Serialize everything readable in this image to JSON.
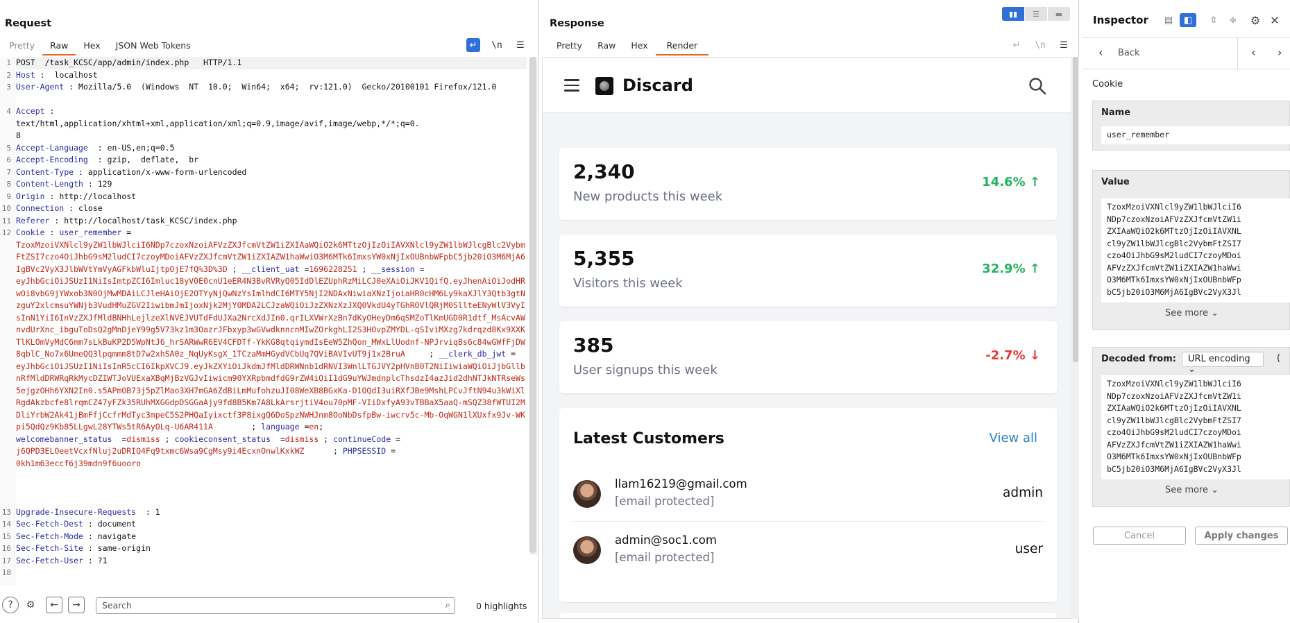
{
  "request": {
    "title": "Request",
    "tabs": [
      "Pretty",
      "Raw",
      "Hex",
      "JSON Web Tokens"
    ],
    "active_tab": "Raw",
    "lines": [
      {
        "n": "1",
        "h": 1,
        "parts": [
          {
            "c": "plain",
            "t": "POST  /task_KCSC/app/admin/index.php   HTTP/1.1"
          }
        ]
      },
      {
        "n": "2",
        "h": 1,
        "parts": [
          {
            "c": "hk",
            "t": "Host"
          },
          {
            "c": "sep",
            "t": " :  localhost"
          }
        ]
      },
      {
        "n": "3",
        "h": 2,
        "parts": [
          {
            "c": "hk",
            "t": "User-Agent"
          },
          {
            "c": "sep",
            "t": " : Mozilla/5.0  (Windows  NT  10.0;  Win64;  x64;  rv:121.0)  Gecko/20100101 Firefox/121.0"
          }
        ]
      },
      {
        "n": "4",
        "h": 3,
        "parts": [
          {
            "c": "hk",
            "t": "Accept"
          },
          {
            "c": "sep",
            "t": " :\ntext/html,application/xhtml+xml,application/xml;q=0.9,image/avif,image/webp,*/*;q=0.\n8"
          }
        ]
      },
      {
        "n": "5",
        "h": 1,
        "parts": [
          {
            "c": "hk",
            "t": "Accept-Language"
          },
          {
            "c": "sep",
            "t": "  : en-US,en;q=0.5"
          }
        ]
      },
      {
        "n": "6",
        "h": 1,
        "parts": [
          {
            "c": "hk",
            "t": "Accept-Encoding"
          },
          {
            "c": "sep",
            "t": "  : gzip,  deflate,  br"
          }
        ]
      },
      {
        "n": "7",
        "h": 1,
        "parts": [
          {
            "c": "hk",
            "t": "Content-Type"
          },
          {
            "c": "sep",
            "t": " : application/x-www-form-urlencoded"
          }
        ]
      },
      {
        "n": "8",
        "h": 1,
        "parts": [
          {
            "c": "hk",
            "t": "Content-Length"
          },
          {
            "c": "sep",
            "t": " : 129"
          }
        ]
      },
      {
        "n": "9",
        "h": 1,
        "parts": [
          {
            "c": "hk",
            "t": "Origin"
          },
          {
            "c": "sep",
            "t": " : http://localhost"
          }
        ]
      },
      {
        "n": "10",
        "h": 1,
        "parts": [
          {
            "c": "hk",
            "t": "Connection"
          },
          {
            "c": "sep",
            "t": " : close"
          }
        ]
      },
      {
        "n": "11",
        "h": 1,
        "parts": [
          {
            "c": "hk",
            "t": "Referer"
          },
          {
            "c": "sep",
            "t": " : http://localhost/task_KCSC/index.php"
          }
        ]
      },
      {
        "n": "12",
        "h": 23,
        "parts": [
          {
            "c": "hk",
            "t": "Cookie"
          },
          {
            "c": "sep",
            "t": " : "
          },
          {
            "c": "ck",
            "t": "user_remember"
          },
          {
            "c": "sep",
            "t": " =\n"
          },
          {
            "c": "cv",
            "t": "TzoxMzoiVXNlcl9yZW1lbWJlciI6NDp7czoxNzoiAFVzZXJfcmVtZW1iZXIAaWQiO2k6MTtzOjIzOiIAVXNlcl9yZW1lbWJlcgBlc2VybmFtZSI7czo4OiJhbG9sM2ludCI7czoyMDoiAFVzZXJfcmVtZW1iZXIAZW1haWwiO3M6MTk6ImxsYW0xNjIxOUBnbWFpbC5jb20iO3M6MjA6IgBVc2VyX3JlbWVtYmVyAGFkbWluIjtpOjE7fQ%3D%3D"
          },
          {
            "c": "sep",
            "t": " ; "
          },
          {
            "c": "ck",
            "t": "__client_uat"
          },
          {
            "c": "sep",
            "t": " ="
          },
          {
            "c": "cv",
            "t": "1696228251"
          },
          {
            "c": "sep",
            "t": " ; "
          },
          {
            "c": "ck",
            "t": "__session"
          },
          {
            "c": "sep",
            "t": " =\n"
          },
          {
            "c": "cv",
            "t": "eyJhbGciOiJSUzI1NiIsImtpZCI6Imluc18yV0E0cnU1eER4N3BvRVRyQ05IdDlEZUphRzMiLCJ0eXAiOiJKV1QifQ.eyJhenAiOiJodHRwOi8vbG9jYWxob3N0OjMwMDAiLCJleHAiOjE2OTYyNjQwNzYsImlhdCI6MTY5NjI2NDAxNiwiaXNzIjoiaHR0cHM6Ly9kaXJlY3Qtb3gtNzguY2xlcmsuYWNjb3VudHMuZGV2IiwibmJmIjoxNjk2MjY0MDA2LCJzaWQiOiJzZXNzXzJXQ0VkdU4yTGhROVlQRjM0SllteENyWlV3VyIsInN1YiI6InVzZXJfMldBNHhLejlzeXlNVEJVUTdFdUJXa2NrcXdJIn0.qrILXVWrXzBn7dKyOHeyDm6qSMZoTlKmUGD0R1dtf_MsAcvAWnvdUrXnc_ibguToDsQ2gMnDjeY99g5V73kz1m3OazrJFbxyp3wGVwdknncnMIwZOrkghLI2S3HOvpZMYDL-qSIviMXzg7kdrqzd8Kx9XXKTlKLOmVyMdC6mm7sLkBuKP2D5WpNtJ6_hrSARWwR6EV4CFDTf-YkKG8qtqiymdIsEeW5ZhQon_MWxLlUodnf-NPJrviqBs6c84wGWfFjDW8qblC_No7x6UmeQQ3lpqmmm8tD7w2xhSA0z_NqUyKsgX_1TCzaMmHGydVCbUq7QViBAVIvUT9j1x2BruA"
          },
          {
            "c": "sep",
            "t": "     ; "
          },
          {
            "c": "ck",
            "t": "__clerk_db_jwt"
          },
          {
            "c": "sep",
            "t": " =\n"
          },
          {
            "c": "cv",
            "t": "eyJhbGciOiJSUzI1NiIsInR5cCI6IkpXVCJ9.eyJkZXYiOiJkdmJfMldDRWNnb1dRNVI3WnlLTGJVY2pHVnB0T2NiIiwiaWQiOiJjbGllbnRfMldDRWRqRkMycDZIWTJoVUExaXBqMjBzVGJvIiwicm90YXRpbmdfdG9rZW4iOiI1dG9uYWJmdnplcThsdzI4azJid2dhNTJkNTRseWs5ejgzOHh6YXN2In0.s5APmOB73j5pZlMao3XH7mGA6ZdBiLmMufohzuJI08WeXB8BGxKa-D1OQdI3uiRXfJBe9MshLPCvJftN94u3kWiXlRgdAkzbcfe8lrqmCZ47yFZk35RUhMXGGdpDSGGaAjy9fd8B5Km7A8LkArsrjtiV4ou70pMF-VIiDxfyA93vTBBaX5aaQ-mSQZ38fWTUI2MDliYrbW2Ak41jBmFfjCcfrMdTyc3mpeC5S2PHQaIyixctf3P8ixgQ6DoSpzNWHJnm8OoNbDsfpBw-iwcrv5c-Mb-OqWGN1lXUxfx9Jv-WKpi5QdQz9Kb85LLgwL28YTWs5tR6AyOLq-U6AR411A"
          },
          {
            "c": "sep",
            "t": "        ; "
          },
          {
            "c": "ck",
            "t": "language"
          },
          {
            "c": "sep",
            "t": " ="
          },
          {
            "c": "cv",
            "t": "en"
          },
          {
            "c": "sep",
            "t": ";\n"
          },
          {
            "c": "ck",
            "t": "welcomebanner_status"
          },
          {
            "c": "sep",
            "t": "  ="
          },
          {
            "c": "cv",
            "t": "dismiss"
          },
          {
            "c": "sep",
            "t": " ; "
          },
          {
            "c": "ck",
            "t": "cookieconsent_status"
          },
          {
            "c": "sep",
            "t": "  ="
          },
          {
            "c": "cv",
            "t": "dismiss"
          },
          {
            "c": "sep",
            "t": " ; "
          },
          {
            "c": "ck",
            "t": "continueCode"
          },
          {
            "c": "sep",
            "t": " =\n"
          },
          {
            "c": "cv",
            "t": "j6QPD3ELOeetVcxfNluj2uDRIQ4Fq9txmc6Wsa9CgMsy9i4EcxnOnwlKxkWZ"
          },
          {
            "c": "sep",
            "t": "      ; "
          },
          {
            "c": "ck",
            "t": "PHPSESSID"
          },
          {
            "c": "sep",
            "t": " =\n"
          },
          {
            "c": "cv",
            "t": "0kh1m63eccf6j39mdn9f6uooro"
          }
        ]
      },
      {
        "n": "13",
        "h": 1,
        "parts": [
          {
            "c": "hk",
            "t": "Upgrade-Insecure-Requests"
          },
          {
            "c": "sep",
            "t": "  : 1"
          }
        ]
      },
      {
        "n": "14",
        "h": 1,
        "parts": [
          {
            "c": "hk",
            "t": "Sec-Fetch-Dest"
          },
          {
            "c": "sep",
            "t": " : document"
          }
        ]
      },
      {
        "n": "15",
        "h": 1,
        "parts": [
          {
            "c": "hk",
            "t": "Sec-Fetch-Mode"
          },
          {
            "c": "sep",
            "t": " : navigate"
          }
        ]
      },
      {
        "n": "16",
        "h": 1,
        "parts": [
          {
            "c": "hk",
            "t": "Sec-Fetch-Site"
          },
          {
            "c": "sep",
            "t": " : same-origin"
          }
        ]
      },
      {
        "n": "17",
        "h": 1,
        "parts": [
          {
            "c": "hk",
            "t": "Sec-Fetch-User"
          },
          {
            "c": "sep",
            "t": " : ?1"
          }
        ]
      },
      {
        "n": "18",
        "h": 1,
        "parts": [
          {
            "c": "plain",
            "t": ""
          }
        ]
      }
    ],
    "footer": {
      "search_placeholder": "Search",
      "highlights": "0 highlights"
    }
  },
  "response": {
    "title": "Response",
    "tabs": [
      "Pretty",
      "Raw",
      "Hex",
      "Render"
    ],
    "active_tab": "Render",
    "app": {
      "brand": "Discard",
      "stats": [
        {
          "value": "2,340",
          "label": "New products this week",
          "change": "14.6%",
          "arrow": "↑",
          "trend": "up"
        },
        {
          "value": "5,355",
          "label": "Visitors this week",
          "change": "32.9%",
          "arrow": "↑",
          "trend": "up"
        },
        {
          "value": "385",
          "label": "User signups this week",
          "change": "-2.7%",
          "arrow": "↓",
          "trend": "down"
        }
      ],
      "customers_title": "Latest Customers",
      "view_all": "View all",
      "customers": [
        {
          "email": "llam16219@gmail.com",
          "protected": "[email protected]",
          "role": "admin"
        },
        {
          "email": "admin@soc1.com",
          "protected": "[email protected]",
          "role": "user"
        }
      ]
    }
  },
  "inspector": {
    "title": "Inspector",
    "back": "Back",
    "section_label": "Cookie",
    "name_header": "Name",
    "name_value": "user_remember",
    "value_header": "Value",
    "value_lines": [
      "TzoxMzoiVXNlcl9yZW1lbWJlciI6",
      "NDp7czoxNzoiAFVzZXJfcmVtZW1i",
      "ZXIAaWQiO2k6MTtzOjIzOiIAVXNL",
      "cl9yZW1lbWJlcgBlc2VybmFtZSI7",
      "czo4OiJhbG9sM2ludCI7czoyMDoi",
      "AFVzZXJfcmVtZW1iZXIAZW1haWwi",
      "O3M6MTk6ImxsYW0xNjIxOUBnbWFp",
      "bC5jb20iO3M6MjA6IgBVc2VyX3Jl"
    ],
    "see_more": "See more",
    "decoded_header": "Decoded from:",
    "decoded_from": "URL encoding",
    "decoded_lines": [
      "TzoxMzoiVXNlcl9yZW1lbWJlciI6",
      "NDp7czoxNzoiAFVzZXJfcmVtZW1i",
      "ZXIAaWQiO2k6MTtzOjIzOiIAVXNL",
      "cl9yZW1lbWJlcgBlc2VybmFtZSI7",
      "czo4OiJhbG9sM2ludCI7czoyMDoi",
      "AFVzZXJfcmVtZW1iZXIAZW1haWwi",
      "O3M6MTk6ImxsYW0xNjIxOUBnbWFp",
      "bC5jb20iO3M6MjA6IgBVc2VyX3Jl"
    ],
    "cancel": "Cancel",
    "apply": "Apply changes"
  }
}
